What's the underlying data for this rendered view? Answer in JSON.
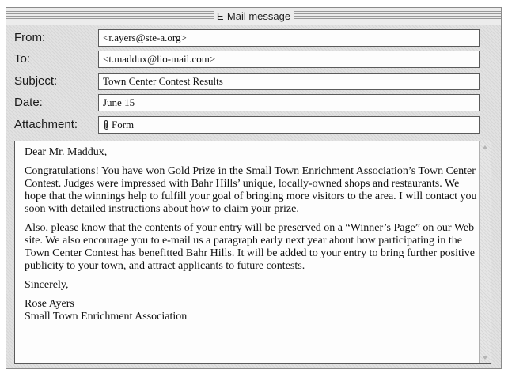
{
  "window": {
    "title": "E-Mail message"
  },
  "header_fields": [
    {
      "label": "From:",
      "value": "<r.ayers@ste-a.org>"
    },
    {
      "label": "To:",
      "value": "<t.maddux@lio-mail.com>"
    },
    {
      "label": "Subject:",
      "value": "Town Center Contest Results"
    },
    {
      "label": "Date:",
      "value": "June 15"
    },
    {
      "label": "Attachment:",
      "value": "Form",
      "icon": "paperclip-icon"
    }
  ],
  "message": {
    "greeting": "Dear Mr. Maddux,",
    "paragraphs": [
      "Congratulations! You have won Gold Prize in the Small Town Enrichment Association’s Town Center Contest. Judges were impressed with Bahr Hills’ unique, locally-owned shops and restaurants. We hope that the winnings help to fulfill your goal of bringing more visitors to the area. I will contact you soon with detailed instructions about how to claim your prize.",
      "Also, please know that the contents of your entry will be preserved on a “Winner’s Page” on our Web site. We also encourage you to e-mail us a paragraph early next year about how participating in the Town Center Contest has benefitted Bahr Hills. It will be added to your entry to bring further positive publicity to your town, and attract applicants to future contests."
    ],
    "closing": "Sincerely,",
    "signature_name": "Rose Ayers",
    "signature_org": "Small Town Enrichment Association"
  }
}
